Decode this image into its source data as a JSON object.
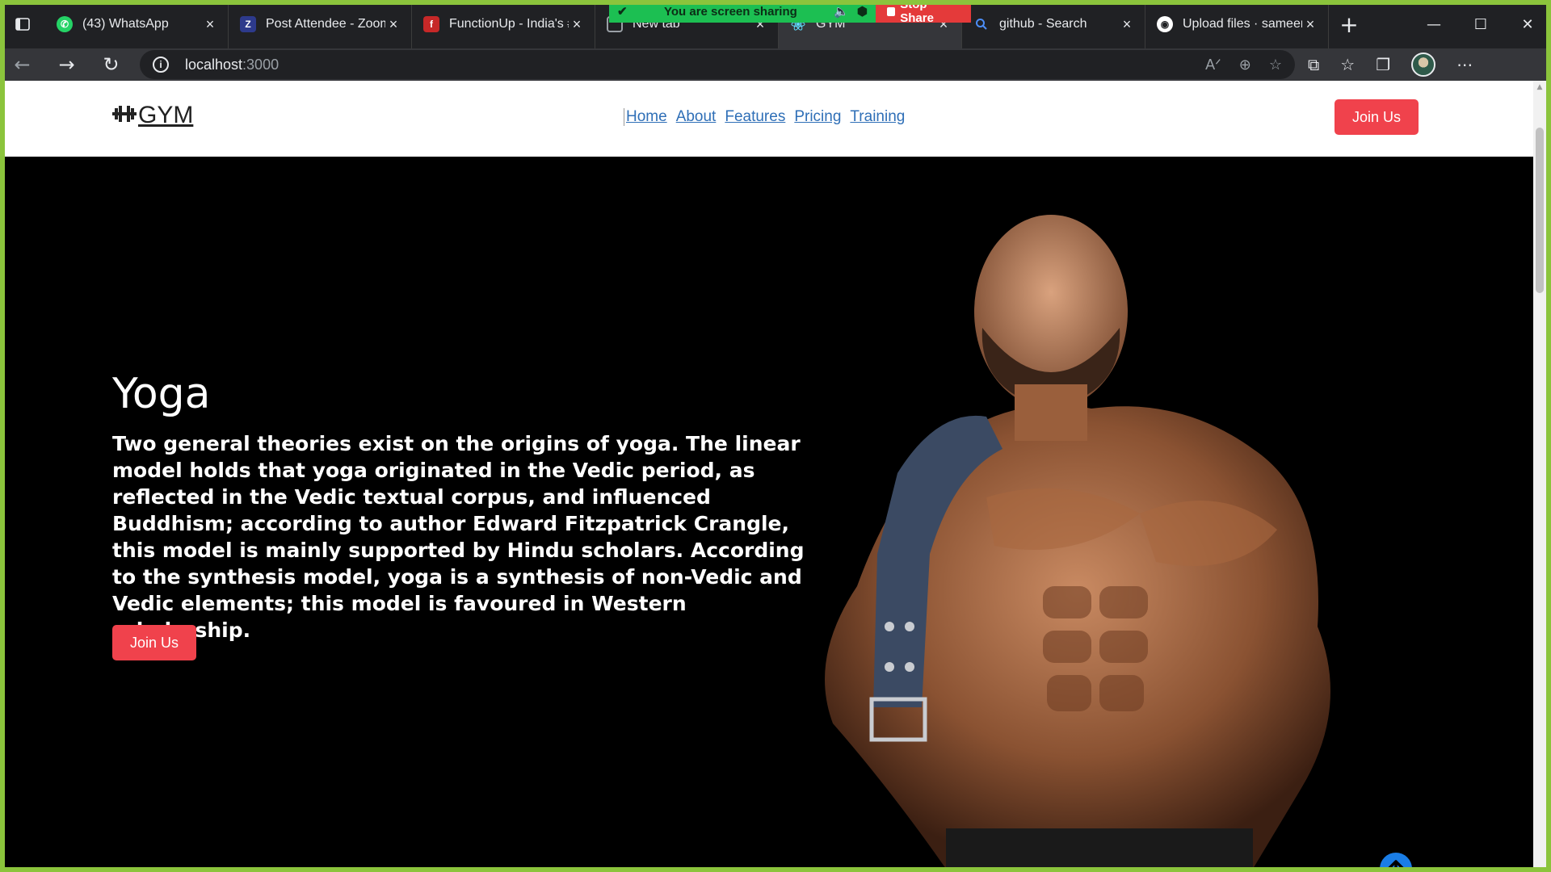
{
  "browser": {
    "tabs": [
      {
        "title": "(43) WhatsApp",
        "favicon": "whatsapp-icon",
        "color": "#25d366",
        "active": false
      },
      {
        "title": "Post Attendee - Zoom",
        "favicon": "zoom-icon",
        "color": "#2d8cff",
        "active": false
      },
      {
        "title": "FunctionUp - India's #",
        "favicon": "functionup-icon",
        "color": "#e53935",
        "active": false
      },
      {
        "title": "New tab",
        "favicon": "newtab-icon",
        "color": "#9aa0a6",
        "active": false
      },
      {
        "title": "GYM",
        "favicon": "react-icon",
        "color": "#61dafb",
        "active": true
      },
      {
        "title": "github - Search",
        "favicon": "search-icon",
        "color": "#4c8df6",
        "active": false
      },
      {
        "title": "Upload files · sameery",
        "favicon": "github-icon",
        "color": "#ffffff",
        "active": false
      }
    ],
    "close_glyph": "×",
    "new_tab_glyph": "+",
    "url_host": "localhost",
    "url_port": ":3000"
  },
  "share_banner": {
    "text": "You are screen sharing",
    "stop_label": "Stop Share",
    "green": "#1cbf52",
    "red": "#e43a3a"
  },
  "site": {
    "logo_text": "GYM",
    "nav": [
      "Home",
      "About",
      "Features",
      "Pricing",
      "Training"
    ],
    "header_cta": "Join Us",
    "hero": {
      "title": "Yoga",
      "text": "Two general theories exist on the origins of yoga. The linear model holds that yoga originated in the Vedic period, as reflected in the Vedic textual corpus, and influenced Buddhism; according to author Edward Fitzpatrick Crangle, this model is mainly supported by Hindu scholars. According to the synthesis model, yoga is a synthesis of non-Vedic and Vedic elements; this model is favoured in Western scholarship.",
      "cta": "Join Us"
    },
    "accent": "#f0424c",
    "link_color": "#2f6fb7",
    "scroll_top_icon": "arrow-up-icon"
  }
}
